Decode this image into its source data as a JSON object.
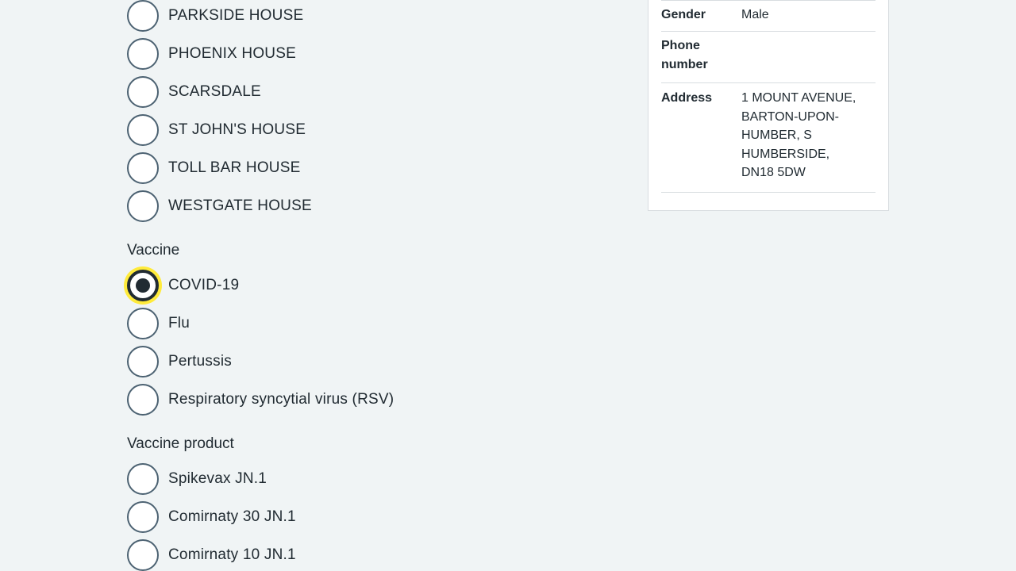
{
  "location_options": [
    {
      "label": "PARKSIDE HOUSE",
      "checked": false
    },
    {
      "label": "PHOENIX HOUSE",
      "checked": false
    },
    {
      "label": "SCARSDALE",
      "checked": false
    },
    {
      "label": "ST JOHN'S HOUSE",
      "checked": false
    },
    {
      "label": "TOLL BAR HOUSE",
      "checked": false
    },
    {
      "label": "WESTGATE HOUSE",
      "checked": false
    }
  ],
  "vaccine": {
    "label": "Vaccine",
    "options": [
      {
        "label": "COVID-19",
        "checked": true
      },
      {
        "label": "Flu",
        "checked": false
      },
      {
        "label": "Pertussis",
        "checked": false
      },
      {
        "label": "Respiratory syncytial virus (RSV)",
        "checked": false
      }
    ]
  },
  "vaccine_product": {
    "label": "Vaccine product",
    "options": [
      {
        "label": "Spikevax JN.1",
        "checked": false
      },
      {
        "label": "Comirnaty 30 JN.1",
        "checked": false
      },
      {
        "label": "Comirnaty 10 JN.1",
        "checked": false
      }
    ]
  },
  "patient_summary": {
    "rows": [
      {
        "key": "Gender",
        "value": "Male"
      },
      {
        "key": "Phone number",
        "value": ""
      },
      {
        "key": "Address",
        "value": "1 MOUNT AVENUE, BARTON-UPON-HUMBER, S HUMBERSIDE, DN18 5DW"
      }
    ]
  },
  "colors": {
    "background": "#f0f4f5",
    "text": "#212b32",
    "radio_border": "#4c6272",
    "focus": "#ffeb3b"
  }
}
